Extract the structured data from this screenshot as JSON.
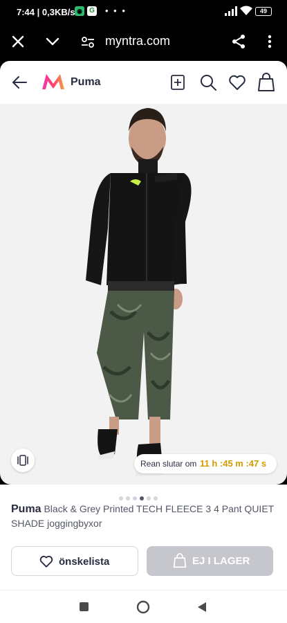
{
  "status_bar": {
    "time": "7:44",
    "net_speed": "0,3KB/s",
    "dots": "• • •",
    "battery": "49"
  },
  "browser": {
    "url": "myntra.com"
  },
  "header": {
    "title": "Puma"
  },
  "product": {
    "sale_label": "Rean slutar om",
    "timer": "11 h :45 m :47 s",
    "image_count": 6,
    "active_image_index": 3,
    "brand": "Puma",
    "name": "Black & Grey Printed TECH FLEECE 3 4 Pant QUIET SHADE joggingbyxor"
  },
  "actions": {
    "wishlist_label": "önskelista",
    "out_of_stock_label": "EJ I LAGER"
  },
  "colors": {
    "brand_pink": "#ff3f6c",
    "timer_gold": "#d49b00",
    "disabled_gray": "#c6c7cc"
  }
}
